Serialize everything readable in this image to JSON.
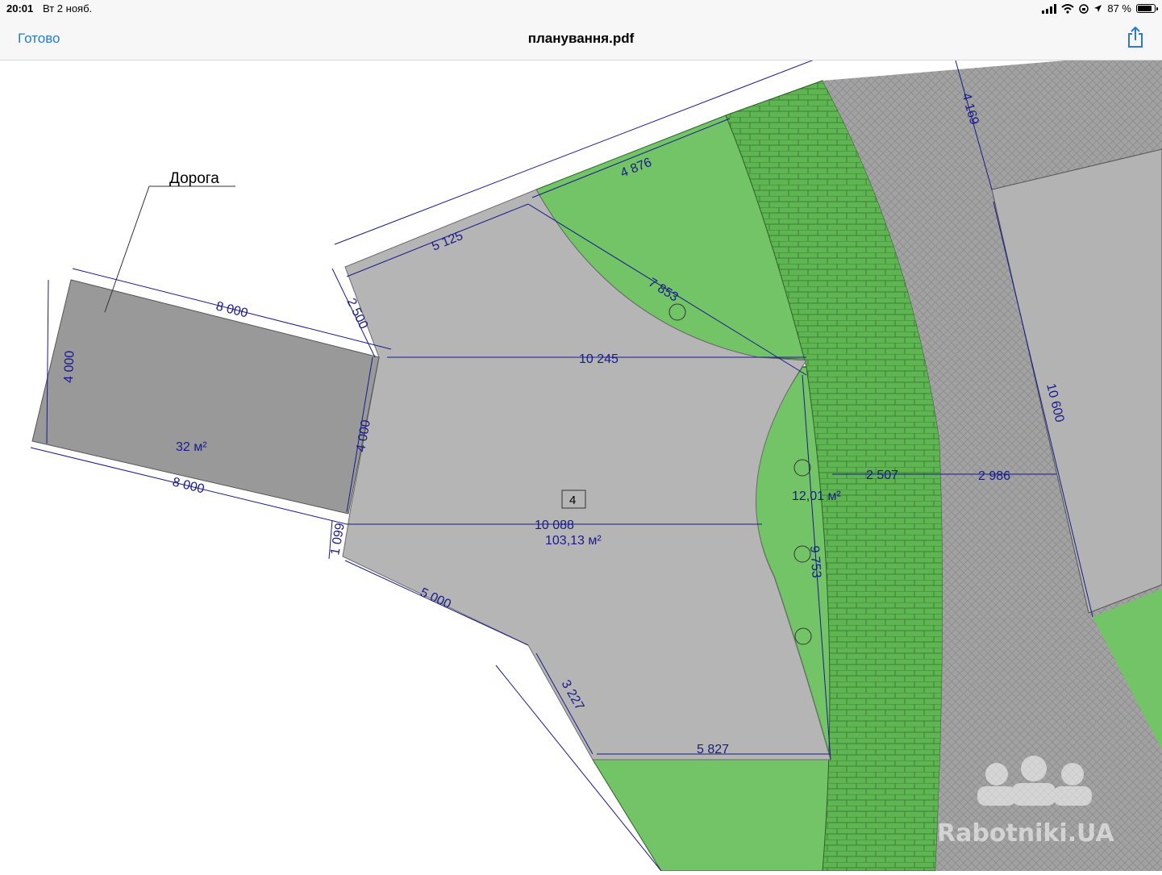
{
  "status_bar": {
    "time": "20:01",
    "date": "Вт 2 нояб.",
    "battery": "87 %",
    "battery_level": 0.87
  },
  "nav": {
    "done_label": "Готово",
    "title": "планування.pdf",
    "share_icon": "share-icon"
  },
  "plan": {
    "road_label": "Дорога",
    "road_area": "32 м²",
    "main_area": "103,13 м²",
    "green_area": "12,01 м²",
    "zone_number": "4",
    "dims": {
      "d8000_top": "8 000",
      "d8000_bottom": "8 000",
      "d4000_left": "4 000",
      "d4000_right": "4 000",
      "d2500": "2 500",
      "d5125": "5 125",
      "d4876": "4 876",
      "d7853": "7 853",
      "d10245": "10 245",
      "d10088": "10 088",
      "d1099": "1 099",
      "d5000": "5 000",
      "d3227": "3 227",
      "d5827": "5 827",
      "d9753": "9 753",
      "d2507": "2 507",
      "d2986": "2 986",
      "d10600": "10 600",
      "d4169": "4 169"
    }
  },
  "watermark": "Rabotniki.UA",
  "colors": {
    "grass": "#72c466",
    "paving": "#a2a2a2",
    "building": "#a9a9a9",
    "road": "#999999",
    "brick": "#5fb552",
    "dimension": "#1a1a8c"
  }
}
